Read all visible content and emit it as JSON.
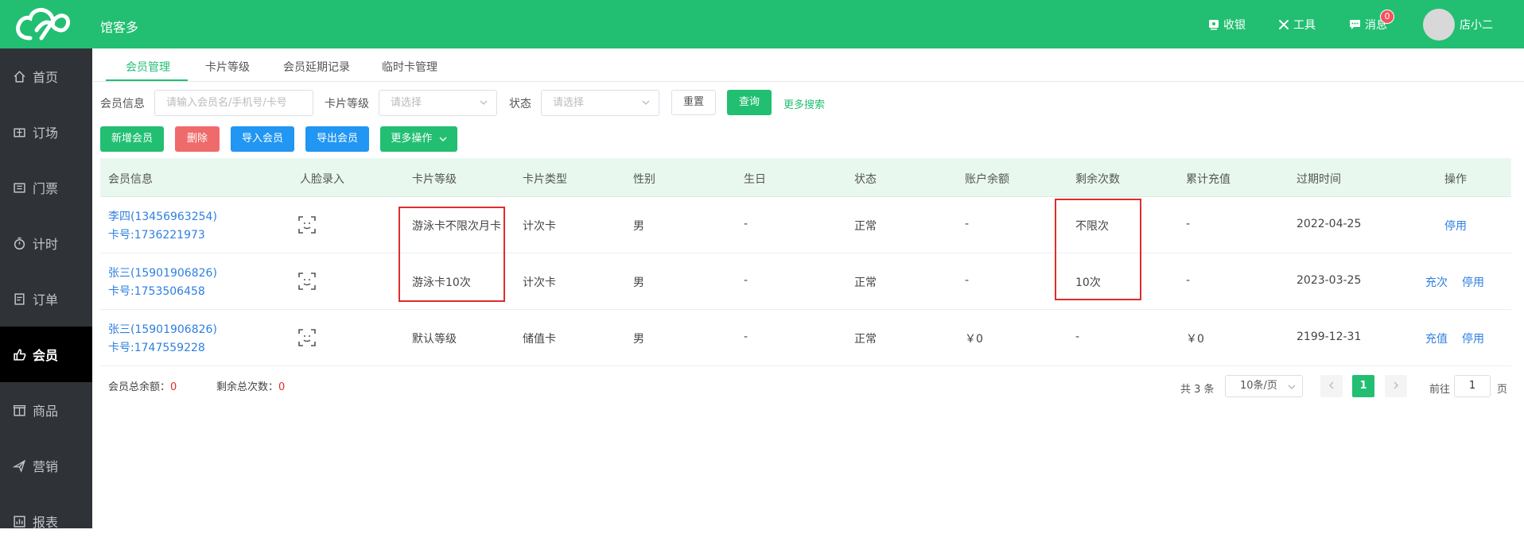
{
  "header": {
    "app_title": "馆客多",
    "cashier": "收银",
    "tools": "工具",
    "messages": "消息",
    "message_count": "0",
    "user": "店小二"
  },
  "sidebar": {
    "items": [
      {
        "label": "首页",
        "icon": "home-icon"
      },
      {
        "label": "订场",
        "icon": "venue-icon"
      },
      {
        "label": "门票",
        "icon": "ticket-icon"
      },
      {
        "label": "计时",
        "icon": "timer-icon"
      },
      {
        "label": "订单",
        "icon": "order-icon"
      },
      {
        "label": "会员",
        "icon": "member-icon"
      },
      {
        "label": "商品",
        "icon": "goods-icon"
      },
      {
        "label": "营销",
        "icon": "marketing-icon"
      },
      {
        "label": "报表",
        "icon": "report-icon"
      }
    ],
    "active": "会员"
  },
  "tabs": [
    "会员管理",
    "卡片等级",
    "会员延期记录",
    "临时卡管理"
  ],
  "filters": {
    "member_info_label": "会员信息",
    "member_info_placeholder": "请输入会员名/手机号/卡号",
    "card_level_label": "卡片等级",
    "card_level_placeholder": "请选择",
    "status_label": "状态",
    "status_placeholder": "请选择",
    "reset": "重置",
    "query": "查询",
    "more_search": "更多搜索"
  },
  "actions": {
    "add": "新增会员",
    "delete": "删除",
    "import": "导入会员",
    "export": "导出会员",
    "more": "更多操作"
  },
  "table": {
    "columns": [
      "会员信息",
      "人脸录入",
      "卡片等级",
      "卡片类型",
      "性别",
      "生日",
      "状态",
      "账户余额",
      "剩余次数",
      "累计充值",
      "过期时间",
      "操作"
    ],
    "rows": [
      {
        "name": "李四(13456963254)",
        "card_no": "卡号:1736221973",
        "level": "游泳卡不限次月卡",
        "type": "计次卡",
        "gender": "男",
        "birthday": "-",
        "status": "正常",
        "balance": "-",
        "remaining": "不限次",
        "recharge": "-",
        "expire": "2022-04-25",
        "ops": [
          "停用"
        ]
      },
      {
        "name": "张三(15901906826)",
        "card_no": "卡号:1753506458",
        "level": "游泳卡10次",
        "type": "计次卡",
        "gender": "男",
        "birthday": "-",
        "status": "正常",
        "balance": "-",
        "remaining": "10次",
        "recharge": "-",
        "expire": "2023-03-25",
        "ops": [
          "充次",
          "停用"
        ]
      },
      {
        "name": "张三(15901906826)",
        "card_no": "卡号:1747559228",
        "level": "默认等级",
        "type": "储值卡",
        "gender": "男",
        "birthday": "-",
        "status": "正常",
        "balance": "￥0",
        "remaining": "-",
        "recharge": "￥0",
        "expire": "2199-12-31",
        "ops": [
          "充值",
          "停用"
        ]
      }
    ]
  },
  "summary": {
    "total_balance_label": "会员总余额：",
    "total_balance": "0",
    "total_times_label": "剩余总次数：",
    "total_times": "0"
  },
  "pagination": {
    "total": "共 3 条",
    "page_size": "10条/页",
    "current": "1",
    "goto_label": "前往",
    "goto_value": "1",
    "page_unit": "页"
  },
  "colors": {
    "brand": "#22bf72",
    "sidebar": "#2f3236",
    "highlight": "#e02b2b",
    "link": "#2e7fe0"
  }
}
